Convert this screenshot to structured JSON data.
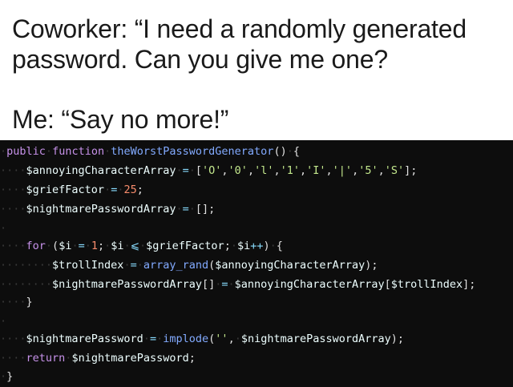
{
  "caption": {
    "line1": "Coworker: “I need a randomly generated",
    "line2": "password. Can you give me one?",
    "line3": "Me: “Say no more!”"
  },
  "code": {
    "lines": [
      "·public·function·theWorstPasswordGenerator()·{",
      "····$annoyingCharacterArray·=·['O','0','l','1','I','|','5','S'];",
      "····$griefFactor·=·25;",
      "····$nightmarePasswordArray·=·[];",
      "·",
      "····for·($i·=·1;·$i·⩽·$griefFactor;·$i++)·{",
      "········$trollIndex·=·array_rand($annoyingCharacterArray);",
      "········$nightmarePasswordArray[]·=·$annoyingCharacterArray[$trollIndex];",
      "····}",
      "·",
      "····$nightmarePassword·=·implode('',·$nightmarePasswordArray);",
      "····return·$nightmarePassword;",
      "·}"
    ]
  }
}
